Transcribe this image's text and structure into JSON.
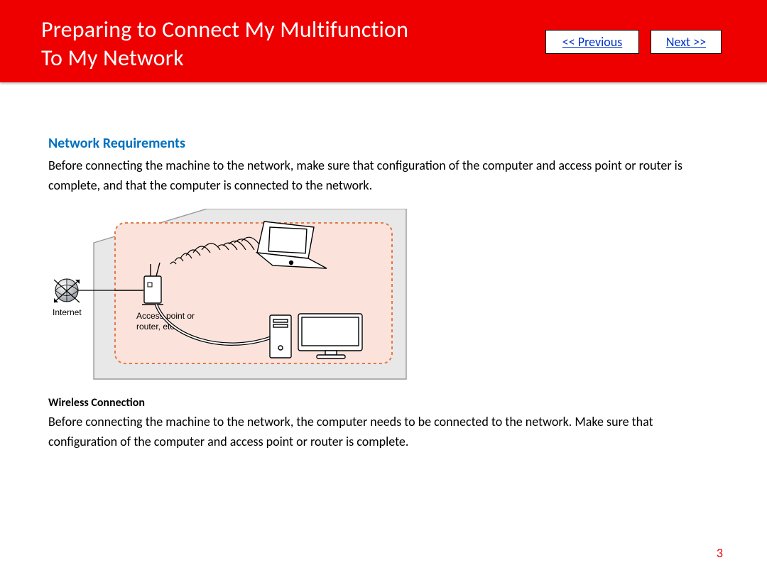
{
  "header": {
    "title_line1": "Preparing to Connect My Multifunction",
    "title_line2": "To My Network",
    "previous_label": "<< Previous",
    "next_label": "Next >>"
  },
  "body": {
    "section_heading": "Network Requirements",
    "intro_paragraph": "Before connecting the machine to the network, make sure that configuration of the computer and access point or router is complete, and that the computer is connected to the network.",
    "diagram": {
      "internet_label": "Internet",
      "access_point_label_line1": "Access point or",
      "access_point_label_line2": "router, etc."
    },
    "subheading": "Wireless Connection",
    "wireless_paragraph": "Before connecting the machine to the network, the computer needs to be connected to the network. Make sure that configuration of the computer and access point or router is complete."
  },
  "page_number": "3"
}
